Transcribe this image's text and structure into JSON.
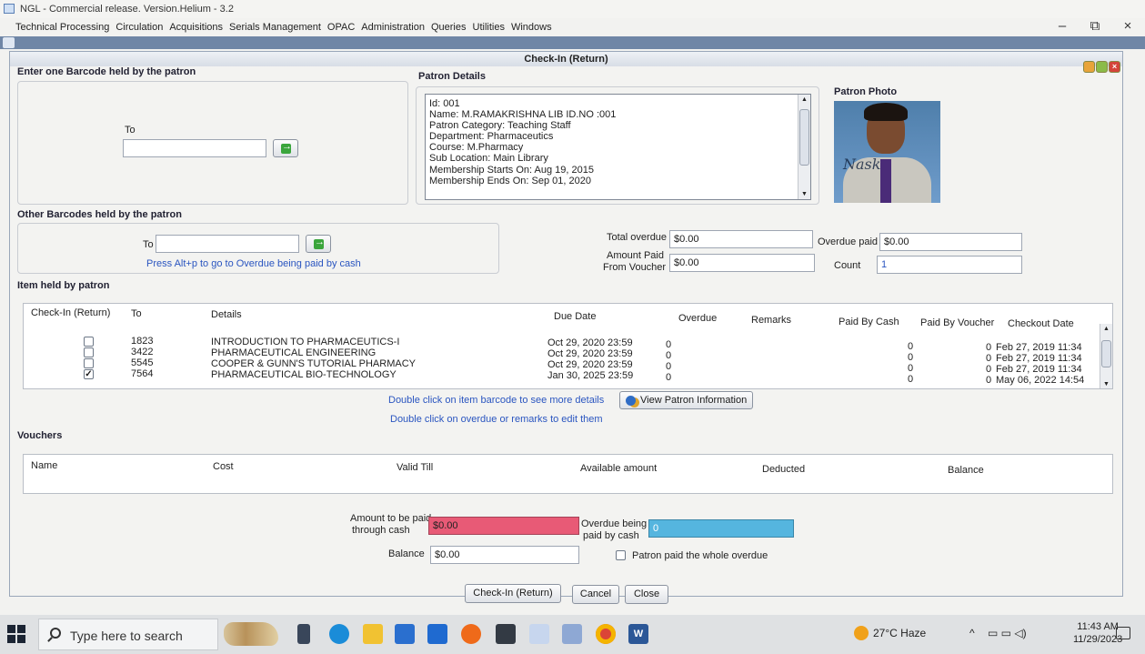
{
  "window": {
    "title": "NGL - Commercial release. Version.Helium - 3.2",
    "controls": {
      "minimize": "–",
      "restore": "⧉",
      "close": "×"
    }
  },
  "menu": [
    "Technical Processing",
    "Circulation",
    "Acquisitions",
    "Serials Management",
    "OPAC",
    "Administration",
    "Queries",
    "Utilities",
    "Windows"
  ],
  "frame": {
    "title": "Check-In (Return)"
  },
  "barcode_section": {
    "title": "Enter one Barcode held by the patron",
    "to_label": "To",
    "to_value": ""
  },
  "patron_details": {
    "title": "Patron Details",
    "lines": [
      "Id: 001",
      "Name: M.RAMAKRISHNA LIB ID.NO :001",
      "Patron Category: Teaching Staff",
      "Department: Pharmaceutics",
      "Course: M.Pharmacy",
      "Sub Location: Main Library",
      "Membership Starts On: Aug 19, 2015",
      "Membership Ends On: Sep 01, 2020"
    ]
  },
  "patron_photo": {
    "title": "Patron Photo",
    "signature": "Nask"
  },
  "other_barcodes": {
    "title": "Other Barcodes held by the patron",
    "to_label": "To",
    "to_value": "",
    "hint": "Press Alt+p to go to Overdue being paid by cash"
  },
  "totals": {
    "total_overdue_label": "Total overdue",
    "total_overdue_value": "$0.00",
    "overdue_paid_label": "Overdue paid",
    "overdue_paid_value": "$0.00",
    "amount_paid_voucher_label_1": "Amount Paid",
    "amount_paid_voucher_label_2": "From Voucher",
    "amount_paid_voucher_value": "$0.00",
    "count_label": "Count",
    "count_value": "1"
  },
  "items": {
    "title": "Item held by patron",
    "columns": [
      "Check-In (Return)",
      "To",
      "Details",
      "Due Date",
      "Overdue",
      "Remarks",
      "Paid By Cash",
      "Paid By Voucher",
      "Checkout Date"
    ],
    "rows": [
      {
        "checked": false,
        "to": "1823",
        "details": "INTRODUCTION TO PHARMACEUTICS-I",
        "due": "Oct 29, 2020 23:59",
        "overdue": "0",
        "remarks": "",
        "cash": "0",
        "voucher": "0",
        "checkout": "Feb 27, 2019 11:34"
      },
      {
        "checked": false,
        "to": "3422",
        "details": "PHARMACEUTICAL ENGINEERING",
        "due": "Oct 29, 2020 23:59",
        "overdue": "0",
        "remarks": "",
        "cash": "0",
        "voucher": "0",
        "checkout": "Feb 27, 2019 11:34"
      },
      {
        "checked": false,
        "to": "5545",
        "details": "COOPER & GUNN'S TUTORIAL PHARMACY",
        "due": "Oct 29, 2020 23:59",
        "overdue": "0",
        "remarks": "",
        "cash": "0",
        "voucher": "0",
        "checkout": "Feb 27, 2019 11:34"
      },
      {
        "checked": true,
        "to": "7564",
        "details": "PHARMACEUTICAL BIO-TECHNOLOGY",
        "due": "Jan 30, 2025 23:59",
        "overdue": "0",
        "remarks": "",
        "cash": "0",
        "voucher": "0",
        "checkout": "May 06, 2022 14:54"
      }
    ],
    "hint_barcode": "Double click on item barcode to see more details",
    "view_patron_button": "View Patron Information",
    "hint_overdue": "Double click on overdue or remarks to edit them"
  },
  "vouchers": {
    "title": "Vouchers",
    "columns": [
      "Name",
      "Cost",
      "Valid Till",
      "Available amount",
      "Deducted",
      "Balance"
    ]
  },
  "payment": {
    "amount_cash_label_1": "Amount to be paid",
    "amount_cash_label_2": "through cash",
    "amount_cash_value": "$0.00",
    "overdue_cash_label_1": "Overdue being",
    "overdue_cash_label_2": "paid by cash",
    "overdue_cash_value": "0",
    "balance_label": "Balance",
    "balance_value": "$0.00",
    "paid_whole_label": "Patron paid the whole overdue"
  },
  "buttons": {
    "checkin": "Check-In (Return)",
    "cancel": "Cancel",
    "close": "Close"
  },
  "taskbar": {
    "search_placeholder": "Type here to search",
    "weather": "27°C  Haze",
    "time": "11:43 AM",
    "date": "11/29/2023"
  },
  "colors": {
    "amount_cash": "#e85a76",
    "overdue_cash": "#55b5df",
    "link": "#2a55c0"
  }
}
